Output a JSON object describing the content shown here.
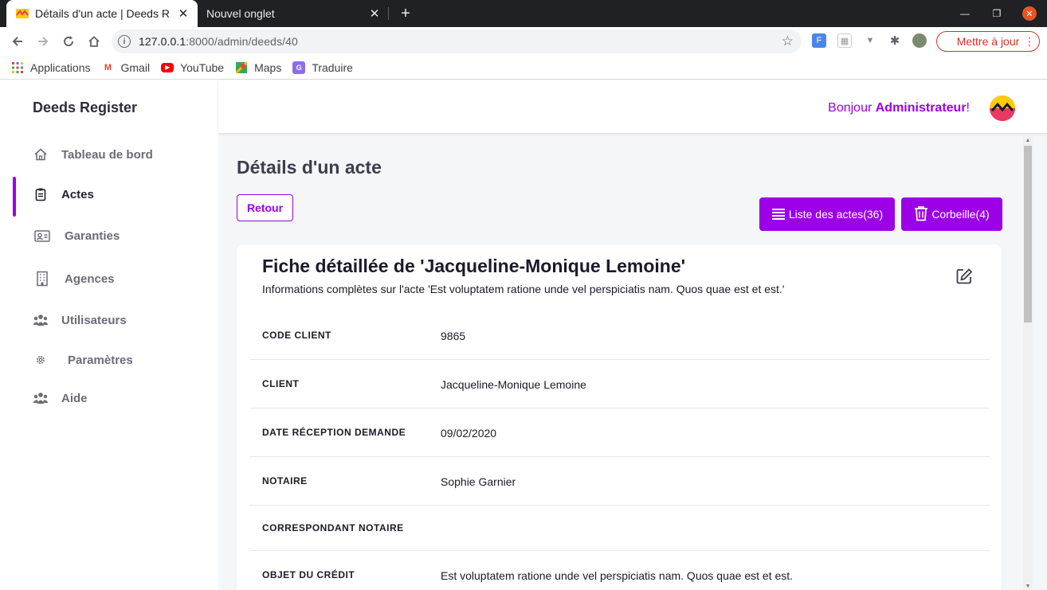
{
  "browser": {
    "active_tab_title": "Détails d'un acte | Deeds R",
    "inactive_tab_title": "Nouvel onglet",
    "url_host": "127.0.0.1",
    "url_path": ":8000/admin/deeds/40",
    "update_label": "Mettre à jour",
    "bookmarks": [
      "Applications",
      "Gmail",
      "YouTube",
      "Maps",
      "Traduire"
    ]
  },
  "app": {
    "brand": "Deeds Register",
    "greeting_prefix": "Bonjour ",
    "greeting_user": "Administrateur",
    "greeting_suffix": "!",
    "accent_color": "#9b00e6"
  },
  "sidebar": {
    "items": [
      {
        "label": "Tableau de bord",
        "icon": "home-icon"
      },
      {
        "label": "Actes",
        "icon": "clipboard-icon",
        "active": true
      },
      {
        "label": "Garanties",
        "icon": "id-card-icon"
      },
      {
        "label": "Agences",
        "icon": "building-icon"
      },
      {
        "label": "Utilisateurs",
        "icon": "users-icon"
      },
      {
        "label": "Paramètres",
        "icon": "gear-icon"
      },
      {
        "label": "Aide",
        "icon": "users-icon"
      }
    ]
  },
  "page": {
    "title": "Détails d'un acte",
    "back_label": "Retour",
    "list_label": "Liste des actes(36)",
    "trash_label": "Corbeille(4)"
  },
  "card": {
    "title": "Fiche détaillée de 'Jacqueline-Monique Lemoine'",
    "subtitle": "Informations complètes sur l'acte 'Est voluptatem ratione unde vel perspiciatis nam. Quos quae est et est.'",
    "rows": [
      {
        "label": "CODE CLIENT",
        "value": "9865"
      },
      {
        "label": "CLIENT",
        "value": "Jacqueline-Monique Lemoine"
      },
      {
        "label": "DATE RÉCEPTION DEMANDE",
        "value": "09/02/2020"
      },
      {
        "label": "NOTAIRE",
        "value": "Sophie Garnier"
      },
      {
        "label": "CORRESPONDANT NOTAIRE",
        "value": ""
      },
      {
        "label": "OBJET DU CRÉDIT",
        "value": "Est voluptatem ratione unde vel perspiciatis nam. Quos quae est et est."
      }
    ]
  }
}
